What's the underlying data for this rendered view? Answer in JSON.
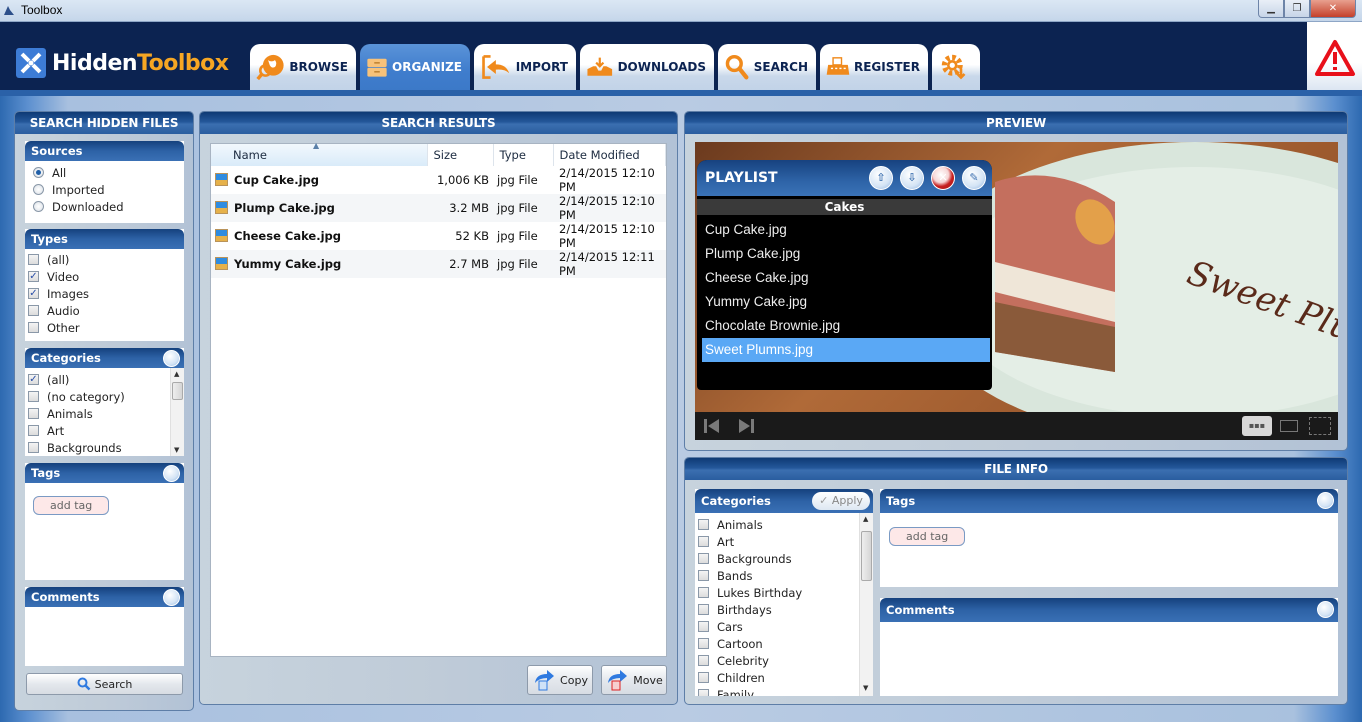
{
  "window": {
    "title": "Toolbox",
    "controls": [
      "minimize",
      "restore",
      "close"
    ]
  },
  "app": {
    "logo_part1": "Hidden",
    "logo_part2": "Toolbox",
    "accent": "#f6a623",
    "brand_blue": "#0c2351"
  },
  "tabs": [
    {
      "label": "BROWSE",
      "icon": "browse-globe-icon",
      "active": false
    },
    {
      "label": "ORGANIZE",
      "icon": "cabinet-icon",
      "active": true
    },
    {
      "label": "IMPORT",
      "icon": "import-arrow-icon",
      "active": false
    },
    {
      "label": "DOWNLOADS",
      "icon": "download-tray-icon",
      "active": false
    },
    {
      "label": "SEARCH",
      "icon": "magnifier-icon",
      "active": false
    },
    {
      "label": "REGISTER",
      "icon": "typewriter-icon",
      "active": false
    },
    {
      "label": "",
      "icon": "settings-gear-icon",
      "active": false
    }
  ],
  "alert": {
    "icon": "warning-triangle-icon"
  },
  "search_panel": {
    "title": "SEARCH HIDDEN FILES",
    "sources": {
      "title": "Sources",
      "options": [
        {
          "label": "All",
          "selected": true
        },
        {
          "label": "Imported",
          "selected": false
        },
        {
          "label": "Downloaded",
          "selected": false
        }
      ]
    },
    "types": {
      "title": "Types",
      "options": [
        {
          "label": "(all)",
          "checked": false
        },
        {
          "label": "Video",
          "checked": true
        },
        {
          "label": "Images",
          "checked": true
        },
        {
          "label": "Audio",
          "checked": false
        },
        {
          "label": "Other",
          "checked": false
        }
      ]
    },
    "categories": {
      "title": "Categories",
      "options": [
        {
          "label": "(all)",
          "checked": true
        },
        {
          "label": "(no category)",
          "checked": false
        },
        {
          "label": "Animals",
          "checked": false
        },
        {
          "label": "Art",
          "checked": false
        },
        {
          "label": "Backgrounds",
          "checked": false
        }
      ]
    },
    "tags": {
      "title": "Tags",
      "add_tag": "add tag"
    },
    "comments": {
      "title": "Comments",
      "value": ""
    },
    "search_button": "Search"
  },
  "results_panel": {
    "title": "SEARCH RESULTS",
    "columns": [
      "Name",
      "Size",
      "Type",
      "Date Modified"
    ],
    "sorted_by": "Name",
    "rows": [
      {
        "name": "Cup Cake.jpg",
        "size": "1,006 KB",
        "type": "jpg File",
        "date": "2/14/2015 12:10 PM"
      },
      {
        "name": "Plump Cake.jpg",
        "size": "3.2 MB",
        "type": "jpg File",
        "date": "2/14/2015 12:10 PM"
      },
      {
        "name": "Cheese Cake.jpg",
        "size": "52 KB",
        "type": "jpg File",
        "date": "2/14/2015 12:10 PM"
      },
      {
        "name": "Yummy Cake.jpg",
        "size": "2.7 MB",
        "type": "jpg File",
        "date": "2/14/2015 12:11 PM"
      }
    ],
    "copy_button": "Copy",
    "move_button": "Move"
  },
  "preview_panel": {
    "title": "PREVIEW",
    "playlist": {
      "title": "PLAYLIST",
      "name": "Cakes",
      "items": [
        "Cup Cake.jpg",
        "Plump Cake.jpg",
        "Cheese Cake.jpg",
        "Yummy Cake.jpg",
        "Chocolate Brownie.jpg",
        "Sweet Plumns.jpg"
      ],
      "selected_index": 5,
      "actions": [
        "upload-icon",
        "download-icon",
        "remove-icon",
        "clear-icon"
      ]
    },
    "image_caption": "Sweet Plums",
    "controls": [
      "previous-icon",
      "next-icon",
      "grid-view-icon",
      "single-view-icon",
      "fullscreen-icon"
    ]
  },
  "file_info_panel": {
    "title": "FILE INFO",
    "categories": {
      "title": "Categories",
      "apply_button": "Apply",
      "options": [
        "Animals",
        "Art",
        "Backgrounds",
        "Bands",
        "Lukes Birthday",
        "Birthdays",
        "Cars",
        "Cartoon",
        "Celebrity",
        "Children",
        "Family"
      ]
    },
    "tags": {
      "title": "Tags",
      "add_tag": "add tag"
    },
    "comments": {
      "title": "Comments",
      "value": ""
    }
  }
}
